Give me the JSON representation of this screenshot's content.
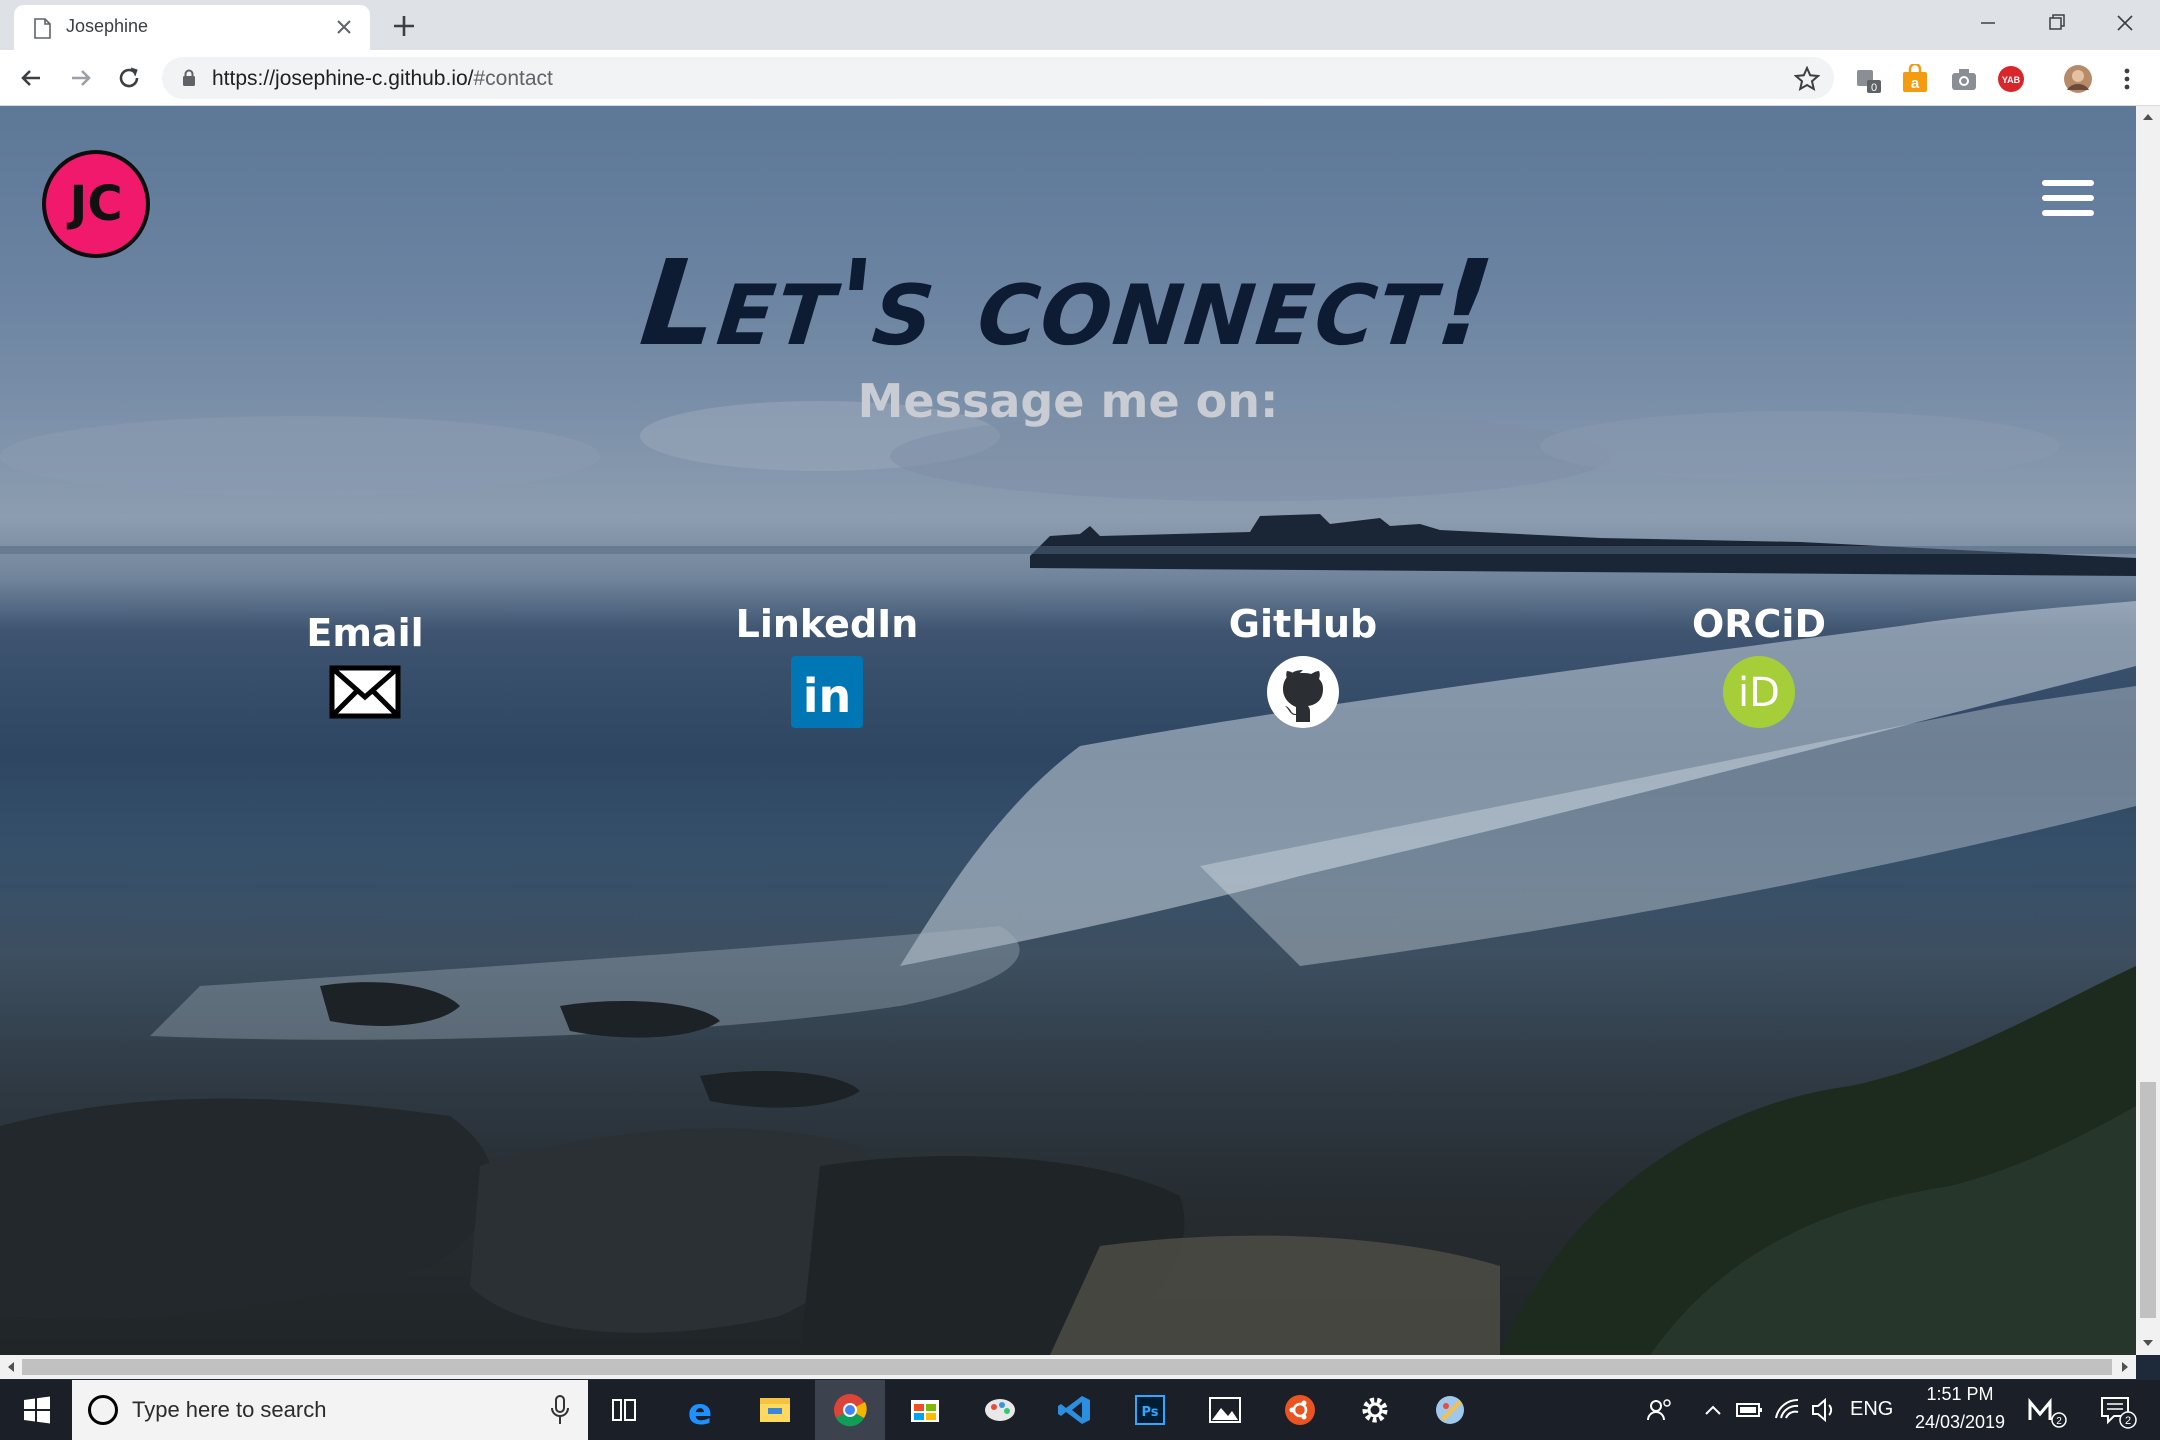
{
  "browser": {
    "tab_title": "Josephine",
    "url_host": "https://josephine-c.github.io/",
    "url_fragment": "#contact",
    "extensions": [
      "0",
      "a",
      "YAB"
    ]
  },
  "page": {
    "logo_text": "JC",
    "headline": "Let's connect!",
    "subhead": "Message me on:",
    "contacts": [
      {
        "label": "Email"
      },
      {
        "label": "LinkedIn",
        "icon_text": "in"
      },
      {
        "label": "GitHub"
      },
      {
        "label": "ORCiD",
        "icon_text": "iD"
      }
    ]
  },
  "taskbar": {
    "search_placeholder": "Type here to search",
    "language": "ENG",
    "time": "1:51 PM",
    "date": "24/03/2019",
    "notifications": "2"
  },
  "colors": {
    "logo_pink": "#f0196b",
    "headline": "#0d1b33",
    "linkedin": "#0077b5",
    "orcid": "#a6ce39"
  }
}
